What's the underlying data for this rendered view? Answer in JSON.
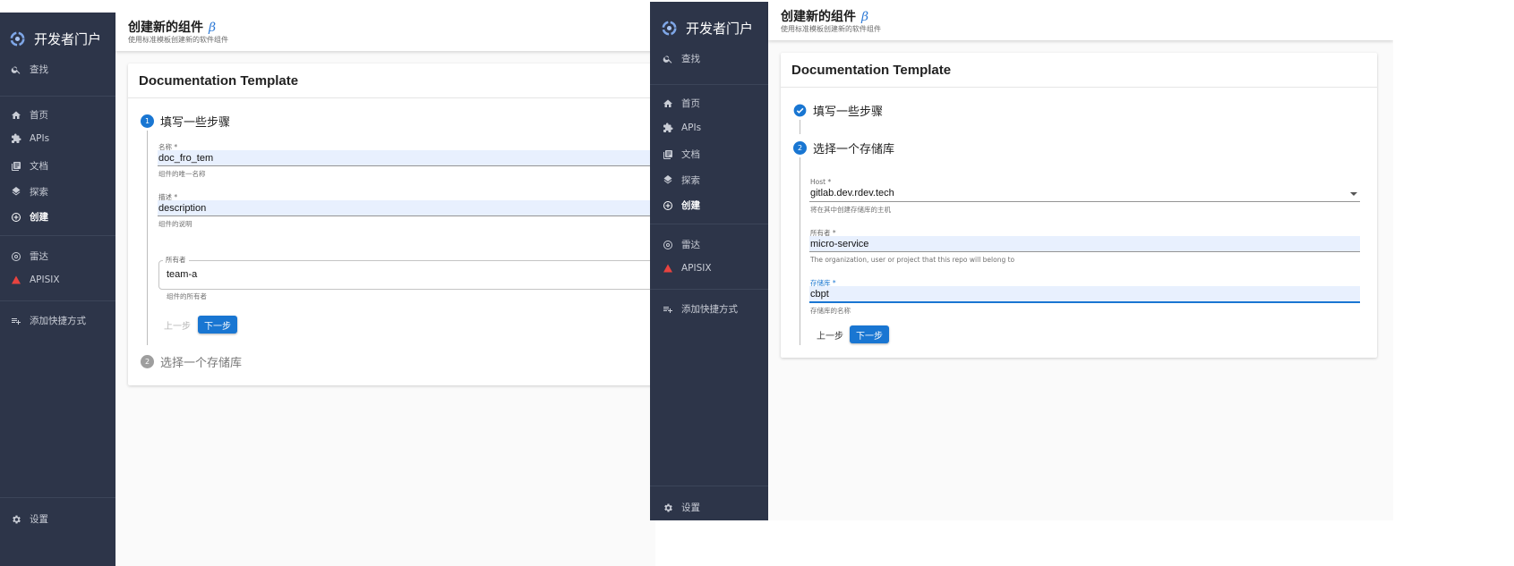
{
  "app": {
    "name": "开发者门户",
    "search_label": "查找",
    "nav": [
      {
        "key": "home",
        "label": "首页",
        "icon": "home-icon"
      },
      {
        "key": "apis",
        "label": "APIs",
        "icon": "puzzle-icon"
      },
      {
        "key": "docs",
        "label": "文档",
        "icon": "library-icon"
      },
      {
        "key": "explore",
        "label": "探索",
        "icon": "layers-icon"
      },
      {
        "key": "create",
        "label": "创建",
        "icon": "add-circle-icon",
        "active": true
      }
    ],
    "nav2": [
      {
        "key": "radar",
        "label": "雷达",
        "icon": "radar-icon"
      },
      {
        "key": "apisix",
        "label": "APISIX",
        "icon": "apisix-icon"
      }
    ],
    "shortcut_label": "添加快捷方式",
    "settings_label": "设置",
    "colors": {
      "sidebar": "#2d3549",
      "accent": "#1976d2",
      "field_fill": "#e8f0fe",
      "apisix": "#e8433f"
    }
  },
  "header": {
    "title": "创建新的组件",
    "beta": "β",
    "subtitle": "使用标准模板创建新的软件组件"
  },
  "card": {
    "title": "Documentation Template"
  },
  "steps": {
    "step1": {
      "num": "1",
      "label": "填写一些步骤"
    },
    "step2": {
      "num": "2",
      "label": "选择一个存储库"
    }
  },
  "left_form": {
    "name": {
      "label": "名称 *",
      "value": "doc_fro_tem",
      "helper": "组件的唯一名称"
    },
    "description": {
      "label": "描述 *",
      "value": "description",
      "helper": "组件的说明"
    },
    "owner": {
      "label": "所有者",
      "value": "team-a",
      "helper": "组件的所有者"
    },
    "back_label": "上一步",
    "next_label": "下一步"
  },
  "right_form": {
    "host": {
      "label": "Host *",
      "value": "gitlab.dev.rdev.tech",
      "helper": "将在其中创建存储库的主机"
    },
    "owner": {
      "label": "所有者 *",
      "value": "micro-service",
      "helper": "The organization, user or project that this repo will belong to"
    },
    "repo": {
      "label": "存储库 *",
      "value": "cbpt",
      "helper": "存储库的名称"
    },
    "back_label": "上一步",
    "next_label": "下一步"
  }
}
